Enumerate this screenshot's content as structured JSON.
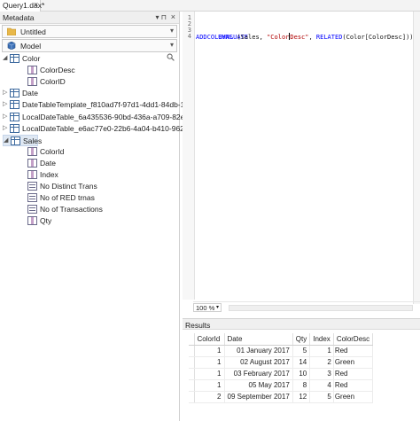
{
  "tab": {
    "title": "Query1.dax*",
    "close_glyph": "×"
  },
  "metadata": {
    "title": "Metadata",
    "pin_glyph": "▾ ⊓",
    "close_glyph": "×",
    "model_combo": {
      "value": "Untitled"
    },
    "perspective_combo": {
      "value": "Model"
    },
    "tree": [
      {
        "label": "Color",
        "kind": "table",
        "expanded": true
      },
      {
        "label": "ColorDesc",
        "kind": "column"
      },
      {
        "label": "ColorID",
        "kind": "column"
      },
      {
        "label": "Date",
        "kind": "table",
        "expanded": false
      },
      {
        "label": "DateTableTemplate_f810ad7f-97d1-4dd1-84db-14",
        "kind": "table",
        "expanded": false
      },
      {
        "label": "LocalDateTable_6a435536-90bd-436a-a709-82e80",
        "kind": "table",
        "expanded": false
      },
      {
        "label": "LocalDateTable_e6ac77e0-22b6-4a04-b410-96223",
        "kind": "table",
        "expanded": false
      },
      {
        "label": "Sales",
        "kind": "table",
        "expanded": true,
        "selected": true
      },
      {
        "label": "ColorId",
        "kind": "column"
      },
      {
        "label": "Date",
        "kind": "column"
      },
      {
        "label": "Index",
        "kind": "column"
      },
      {
        "label": "No Distinct Trans",
        "kind": "measure"
      },
      {
        "label": "No of RED trnas",
        "kind": "measure"
      },
      {
        "label": "No of Transactions",
        "kind": "measure"
      },
      {
        "label": "Qty",
        "kind": "column"
      }
    ]
  },
  "editor": {
    "line_numbers": [
      "1",
      "2",
      "3",
      "4"
    ],
    "line3": "EVALUATE",
    "line4": {
      "kw": "ADDCOLUMNS",
      "t1": " (Sales, ",
      "s1": "\"Color",
      "s2": "Desc\"",
      "t2": ", ",
      "fn": "RELATED",
      "t3": "(Color[ColorDesc]));"
    },
    "zoom": "100 %",
    "zoom_glyph": "▾"
  },
  "results": {
    "title": "Results",
    "columns": [
      "ColorId",
      "Date",
      "Qty",
      "Index",
      "ColorDesc"
    ],
    "rows": [
      [
        "1",
        "01 January 2017",
        "5",
        "1",
        "Red"
      ],
      [
        "1",
        "02 August 2017",
        "14",
        "2",
        "Green"
      ],
      [
        "1",
        "03 February 2017",
        "10",
        "3",
        "Red"
      ],
      [
        "1",
        "05 May 2017",
        "8",
        "4",
        "Red"
      ],
      [
        "2",
        "09 September 2017",
        "12",
        "5",
        "Green"
      ]
    ]
  },
  "colors": {
    "keyword": "#0000ff",
    "string": "#b00000",
    "selection": "#dfe8f3"
  }
}
